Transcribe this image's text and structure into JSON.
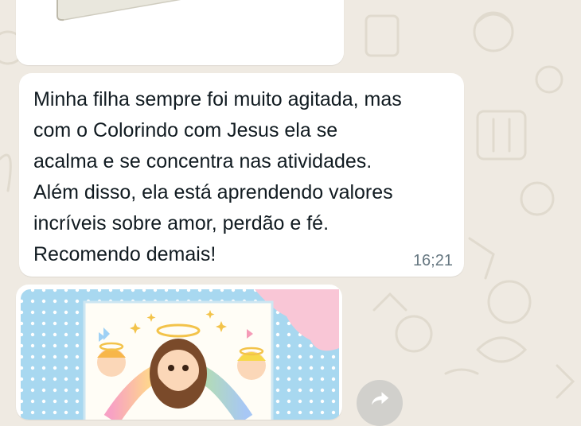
{
  "chat": {
    "message": {
      "text": "Minha filha sempre foi muito agitada, mas\ncom o Colorindo com Jesus ela se\nacalma e se concentra nas atividades.\nAlém disso, ela está aprendendo valores\nincríveis sobre amor, perdão e fé.\nRecomendo demais!",
      "time": "16;21"
    }
  },
  "colors": {
    "wallpaper": "#efeae2",
    "bubble": "#ffffff",
    "timestamp": "#667781"
  },
  "icons": {
    "forward": "forward-icon"
  }
}
